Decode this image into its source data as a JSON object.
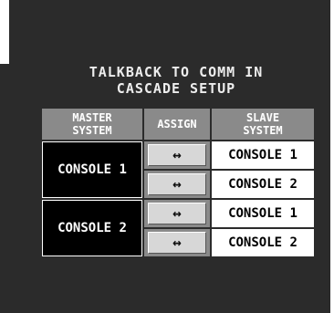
{
  "title_line1": "TALKBACK TO COMM IN",
  "title_line2": "CASCADE SETUP",
  "headers": {
    "master": [
      "MASTER",
      "SYSTEM"
    ],
    "assign": "ASSIGN",
    "slave": [
      "SLAVE",
      "SYSTEM"
    ]
  },
  "master_consoles": [
    "CONSOLE 1",
    "CONSOLE 2"
  ],
  "rows": [
    {
      "assign_symbol": "↔",
      "slave": "CONSOLE 1"
    },
    {
      "assign_symbol": "↔",
      "slave": "CONSOLE 2"
    },
    {
      "assign_symbol": "↔",
      "slave": "CONSOLE 1"
    },
    {
      "assign_symbol": "↔",
      "slave": "CONSOLE 2"
    }
  ],
  "colors": {
    "panel": "#2b2b2b",
    "header": "#8a8a8a",
    "button": "#d7d7d7"
  }
}
